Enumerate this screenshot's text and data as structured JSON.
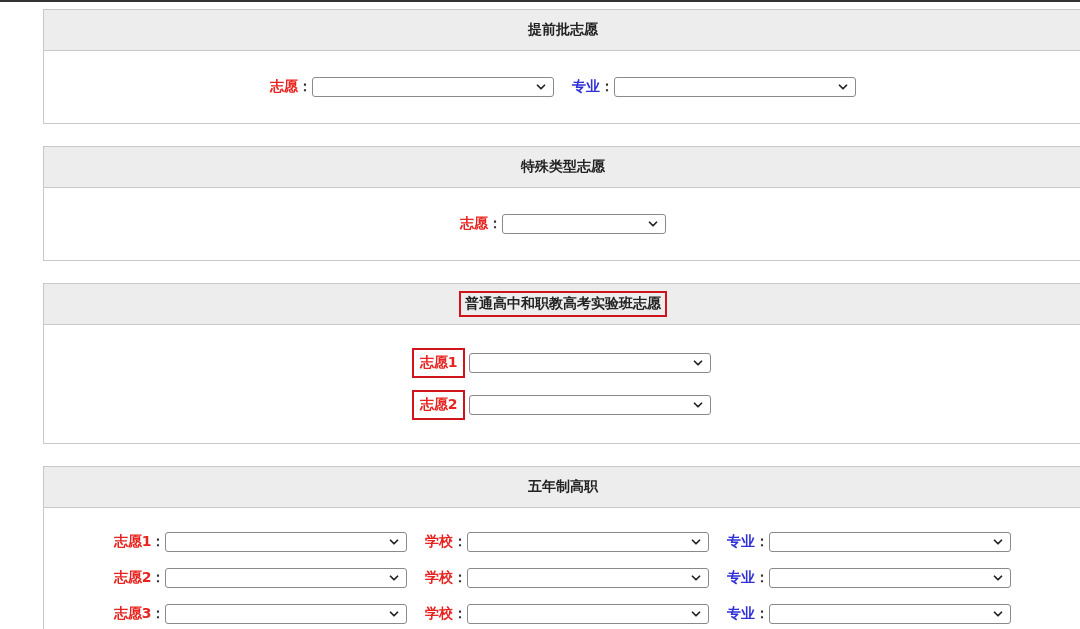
{
  "panels": [
    {
      "title": {
        "text": "提前批志愿",
        "highlighted": false
      },
      "rows": [
        [
          {
            "label": "志愿",
            "separator": "：",
            "color": "#e8231f",
            "highlighted": false
          },
          {
            "label": "专业",
            "separator": "：",
            "color": "#2f2fd6",
            "highlighted": false
          }
        ]
      ]
    },
    {
      "title": {
        "text": "特殊类型志愿",
        "highlighted": false
      },
      "rows": [
        [
          {
            "label": "志愿",
            "separator": "：",
            "color": "#e8231f",
            "highlighted": false,
            "narrow": true
          }
        ]
      ]
    },
    {
      "title": {
        "text": "普通高中和职教高考实验班志愿",
        "highlighted": true
      },
      "rows": [
        [
          {
            "label": "志愿1",
            "color": "#e8231f",
            "highlighted": true
          }
        ],
        [
          {
            "label": "志愿2",
            "color": "#e8231f",
            "highlighted": true
          }
        ]
      ]
    },
    {
      "title": {
        "text": "五年制高职",
        "highlighted": false
      },
      "rows": [
        [
          {
            "label": "志愿1",
            "separator": "：",
            "color": "#e8231f",
            "highlighted": false
          },
          {
            "label": "学校",
            "separator": "：",
            "color": "#e8231f",
            "highlighted": false
          },
          {
            "label": "专业",
            "separator": "：",
            "color": "#2f2fd6",
            "highlighted": false
          }
        ],
        [
          {
            "label": "志愿2",
            "separator": "：",
            "color": "#e8231f",
            "highlighted": false
          },
          {
            "label": "学校",
            "separator": "：",
            "color": "#e8231f",
            "highlighted": false
          },
          {
            "label": "专业",
            "separator": "：",
            "color": "#2f2fd6",
            "highlighted": false
          }
        ],
        [
          {
            "label": "志愿3",
            "separator": "：",
            "color": "#e8231f",
            "highlighted": false
          },
          {
            "label": "学校",
            "separator": "：",
            "color": "#e8231f",
            "highlighted": false
          },
          {
            "label": "专业",
            "separator": "：",
            "color": "#2f2fd6",
            "highlighted": false
          }
        ]
      ]
    }
  ]
}
